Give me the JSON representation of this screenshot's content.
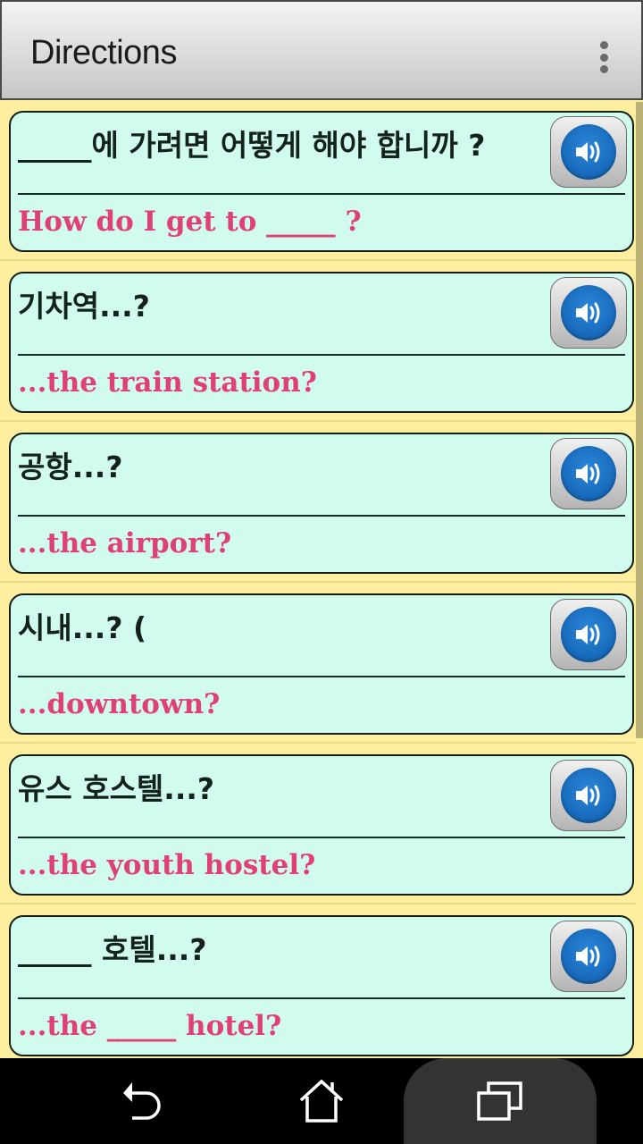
{
  "app_bar": {
    "title": "Directions",
    "overflow_icon": "more-vert-icon"
  },
  "phrases": [
    {
      "korean": "_____에 가려면 어떻게 해야 합니까 ?",
      "english": "How do I get to _____ ?",
      "audio_icon": "speaker-icon"
    },
    {
      "korean": "기차역...?",
      "english": "...the train station?",
      "audio_icon": "speaker-icon"
    },
    {
      "korean": "공항...?",
      "english": "...the airport?",
      "audio_icon": "speaker-icon"
    },
    {
      "korean": "시내...? (",
      "english": "...downtown?",
      "audio_icon": "speaker-icon"
    },
    {
      "korean": "유스 호스텔...?",
      "english": "...the youth hostel?",
      "audio_icon": "speaker-icon"
    },
    {
      "korean": "_____ 호텔...?",
      "english": "...the _____ hotel?",
      "audio_icon": "speaker-icon"
    }
  ],
  "nav_bar": {
    "back": "back-icon",
    "home": "home-icon",
    "recents": "recents-icon"
  },
  "colors": {
    "card_background": "#d2fbf0",
    "list_background": "#fdeea0",
    "english_text": "#e04078",
    "korean_text": "#14221c",
    "speaker_blue": "#1a6fc4"
  }
}
